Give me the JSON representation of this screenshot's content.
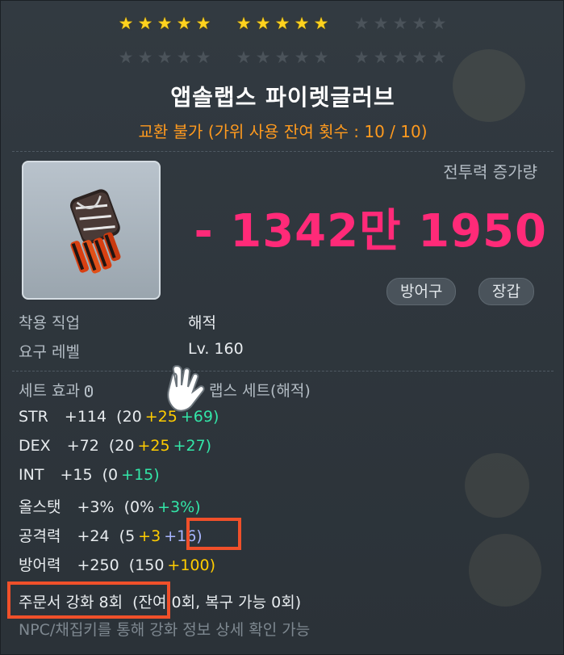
{
  "stars": {
    "row1": [
      [
        "★",
        "★",
        "★",
        "★",
        "★"
      ],
      [
        "★",
        "★",
        "★",
        "★",
        "★"
      ],
      [
        "★",
        "★",
        "★",
        "★",
        "★"
      ]
    ],
    "row1_filled": [
      5,
      5,
      0
    ],
    "row2": [
      [
        "★",
        "★",
        "★",
        "★",
        "★"
      ],
      [
        "★",
        "★",
        "★",
        "★",
        "★"
      ],
      [
        "★",
        "★",
        "★",
        "★",
        "★"
      ]
    ],
    "row2_filled": [
      0,
      0,
      0
    ]
  },
  "item": {
    "name": "앱솔랩스 파이렛글러브",
    "trade_note": "교환 불가 (가위 사용 잔여 횟수 : 10 / 10)",
    "icon": "glove-icon"
  },
  "combat_power": {
    "label": "전투력 증가량",
    "value": "- 1342만 1950"
  },
  "tags": [
    "방어구",
    "장갑"
  ],
  "requirements": {
    "job_label": "착용 직업",
    "job_value": "해적",
    "level_label": "요구 레벨",
    "level_value": "Lv. 160"
  },
  "set_effect": {
    "label": "세트 효과",
    "value": "앱솔랩스 세트(해적)",
    "visible_value": "랩스 세트(해적)"
  },
  "stats": [
    {
      "name": "STR",
      "total": "+114",
      "base": "(20",
      "bonus1": "+25",
      "bonus2": "+69)"
    },
    {
      "name": "DEX",
      "total": "+72",
      "base": "(20",
      "bonus1": "+25",
      "bonus2": "+27)"
    },
    {
      "name": "INT",
      "total": "+15",
      "base": "(0",
      "bonus1": "",
      "bonus2": "+15)"
    },
    {
      "name": "올스탯",
      "total": "+3%",
      "base": "(0%",
      "bonus1": "",
      "bonus2": "+3%)"
    },
    {
      "name": "공격력",
      "total": "+24",
      "base": "(5",
      "bonus1": "+3",
      "bonus2": "+16)"
    },
    {
      "name": "방어력",
      "total": "+250",
      "base": "(150",
      "bonus1": "+100)",
      "bonus2": ""
    }
  ],
  "scroll": {
    "label": "주문서 강화 8회",
    "rest": "(잔여 0회, 복구 가능 0회)"
  },
  "hint": "NPC/채집키를 통해 강화 정보 상세 확인 가능",
  "colors": {
    "accent_pink": "#ff2a78",
    "trade_orange": "#ff9a1e",
    "star_gold": "#ffd21e",
    "bonus_yellow": "#ffcc00",
    "bonus_green": "#33e6a8",
    "bonus_blue": "#a8b6ff",
    "highlight_red": "#f0502a"
  }
}
